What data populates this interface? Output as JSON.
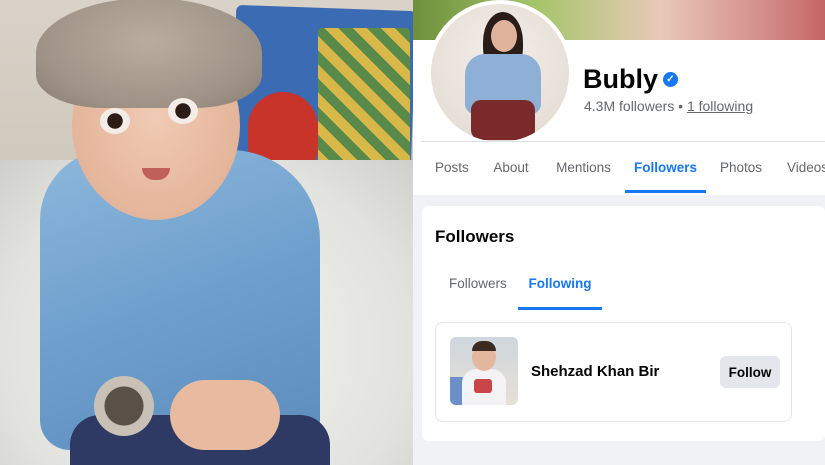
{
  "profile": {
    "name": "Bubly",
    "verified_icon": "verified-badge-icon",
    "followers_count": "4.3M followers",
    "separator": "•",
    "following_count": "1 following"
  },
  "tabs": [
    {
      "label": "Posts",
      "active": false
    },
    {
      "label": "About",
      "active": false
    },
    {
      "label": "Mentions",
      "active": false
    },
    {
      "label": "Followers",
      "active": true
    },
    {
      "label": "Photos",
      "active": false
    },
    {
      "label": "Videos",
      "active": false
    }
  ],
  "followers_section": {
    "title": "Followers",
    "subtabs": [
      {
        "label": "Followers",
        "active": false
      },
      {
        "label": "Following",
        "active": true
      }
    ],
    "people": [
      {
        "name": "Shehzad Khan Bir",
        "button_label": "Follow"
      }
    ]
  },
  "colors": {
    "accent": "#1877f2",
    "text_primary": "#050505",
    "text_secondary": "#65676b",
    "button_bg": "#e4e6eb",
    "page_bg": "#f0f2f5"
  }
}
